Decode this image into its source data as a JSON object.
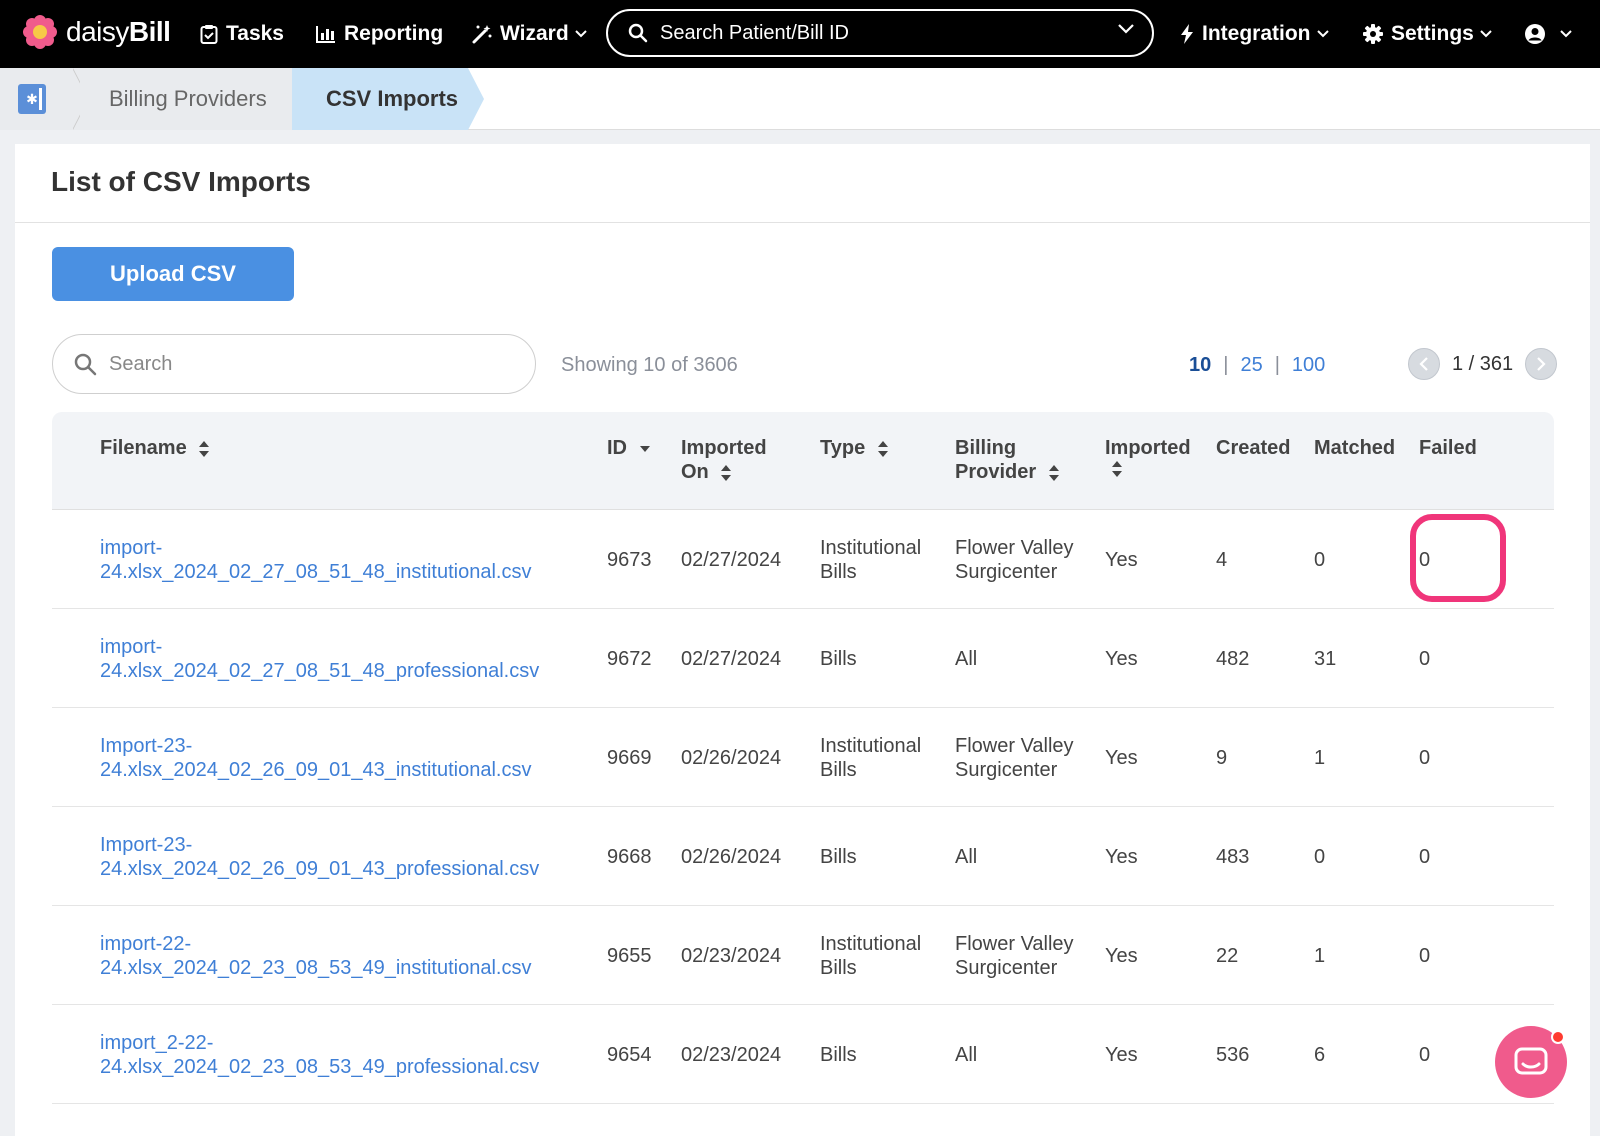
{
  "nav": {
    "logo_light": "daisy",
    "logo_bold": "Bill",
    "tasks": "Tasks",
    "reporting": "Reporting",
    "wizard": "Wizard",
    "search_placeholder": "Search Patient/Bill ID",
    "integration": "Integration",
    "settings": "Settings"
  },
  "breadcrumb": {
    "items": [
      "Billing Providers",
      "CSV Imports"
    ]
  },
  "page": {
    "title": "List of CSV Imports",
    "upload_label": "Upload CSV",
    "search_placeholder": "Search",
    "showing": "Showing 10 of 3606",
    "per_page": [
      "10",
      "25",
      "100"
    ],
    "per_page_sep": "|",
    "page_indicator": "1 / 361"
  },
  "table": {
    "headers": {
      "filename": "Filename",
      "id": "ID",
      "imported_on_1": "Imported",
      "imported_on_2": "On",
      "type": "Type",
      "provider_1": "Billing",
      "provider_2": "Provider",
      "imported": "Imported",
      "created": "Created",
      "matched": "Matched",
      "failed": "Failed"
    },
    "rows": [
      {
        "file1": "import-",
        "file2": "24.xlsx_2024_02_27_08_51_48_institutional.csv",
        "id": "9673",
        "date": "02/27/2024",
        "type1": "Institutional",
        "type2": "Bills",
        "prov1": "Flower Valley",
        "prov2": "Surgicenter",
        "imported": "Yes",
        "created": "4",
        "matched": "0",
        "failed": "0"
      },
      {
        "file1": "import-",
        "file2": "24.xlsx_2024_02_27_08_51_48_professional.csv",
        "id": "9672",
        "date": "02/27/2024",
        "type1": "Bills",
        "type2": "",
        "prov1": "All",
        "prov2": "",
        "imported": "Yes",
        "created": "482",
        "matched": "31",
        "failed": "0"
      },
      {
        "file1": "Import-23-",
        "file2": "24.xlsx_2024_02_26_09_01_43_institutional.csv",
        "id": "9669",
        "date": "02/26/2024",
        "type1": "Institutional",
        "type2": "Bills",
        "prov1": "Flower Valley",
        "prov2": "Surgicenter",
        "imported": "Yes",
        "created": "9",
        "matched": "1",
        "failed": "0"
      },
      {
        "file1": "Import-23-",
        "file2": "24.xlsx_2024_02_26_09_01_43_professional.csv",
        "id": "9668",
        "date": "02/26/2024",
        "type1": "Bills",
        "type2": "",
        "prov1": "All",
        "prov2": "",
        "imported": "Yes",
        "created": "483",
        "matched": "0",
        "failed": "0"
      },
      {
        "file1": "import-22-",
        "file2": "24.xlsx_2024_02_23_08_53_49_institutional.csv",
        "id": "9655",
        "date": "02/23/2024",
        "type1": "Institutional",
        "type2": "Bills",
        "prov1": "Flower Valley",
        "prov2": "Surgicenter",
        "imported": "Yes",
        "created": "22",
        "matched": "1",
        "failed": "0"
      },
      {
        "file1": "import_2-22-",
        "file2": "24.xlsx_2024_02_23_08_53_49_professional.csv",
        "id": "9654",
        "date": "02/23/2024",
        "type1": "Bills",
        "type2": "",
        "prov1": "All",
        "prov2": "",
        "imported": "Yes",
        "created": "536",
        "matched": "6",
        "failed": "0"
      }
    ]
  },
  "colors": {
    "accent": "#4a90e2",
    "link": "#3f7fd6",
    "highlight": "#f0357a",
    "chat": "#f05b8c"
  }
}
